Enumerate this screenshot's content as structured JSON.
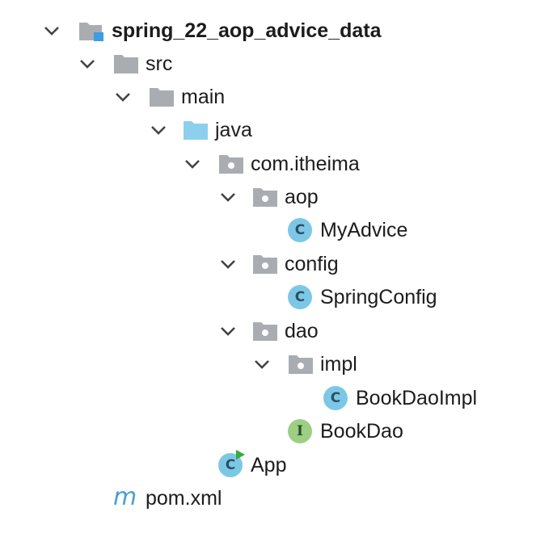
{
  "tree": {
    "project": {
      "label": "spring_22_aop_advice_data"
    },
    "src": {
      "label": "src"
    },
    "main": {
      "label": "main"
    },
    "java": {
      "label": "java"
    },
    "package_root": {
      "label": "com.itheima"
    },
    "aop": {
      "label": "aop"
    },
    "my_advice": {
      "label": "MyAdvice",
      "icon_letter": "C"
    },
    "config": {
      "label": "config"
    },
    "spring_config": {
      "label": "SpringConfig",
      "icon_letter": "C"
    },
    "dao": {
      "label": "dao"
    },
    "impl": {
      "label": "impl"
    },
    "book_dao_impl": {
      "label": "BookDaoImpl",
      "icon_letter": "C"
    },
    "book_dao": {
      "label": "BookDao",
      "icon_letter": "I"
    },
    "app": {
      "label": "App",
      "icon_letter": "C"
    },
    "pom": {
      "label": "pom.xml",
      "icon_letter": "m"
    }
  },
  "icons": {
    "chevron": "chevron-down-icon",
    "module_folder": "module-folder-icon",
    "folder": "folder-icon",
    "source_folder": "source-root-folder-icon",
    "package": "package-icon",
    "class": "class-icon",
    "interface": "interface-icon",
    "runnable_class": "runnable-class-icon",
    "maven": "maven-icon"
  },
  "colors": {
    "folder_gray": "#a9adb2",
    "source_blue": "#8dd0ee",
    "module_blue": "#3a9ee0",
    "class_blue": "#7dc7e6",
    "interface_green": "#9ccf84",
    "run_green": "#3aa83a",
    "maven_blue": "#4a9fd6"
  }
}
